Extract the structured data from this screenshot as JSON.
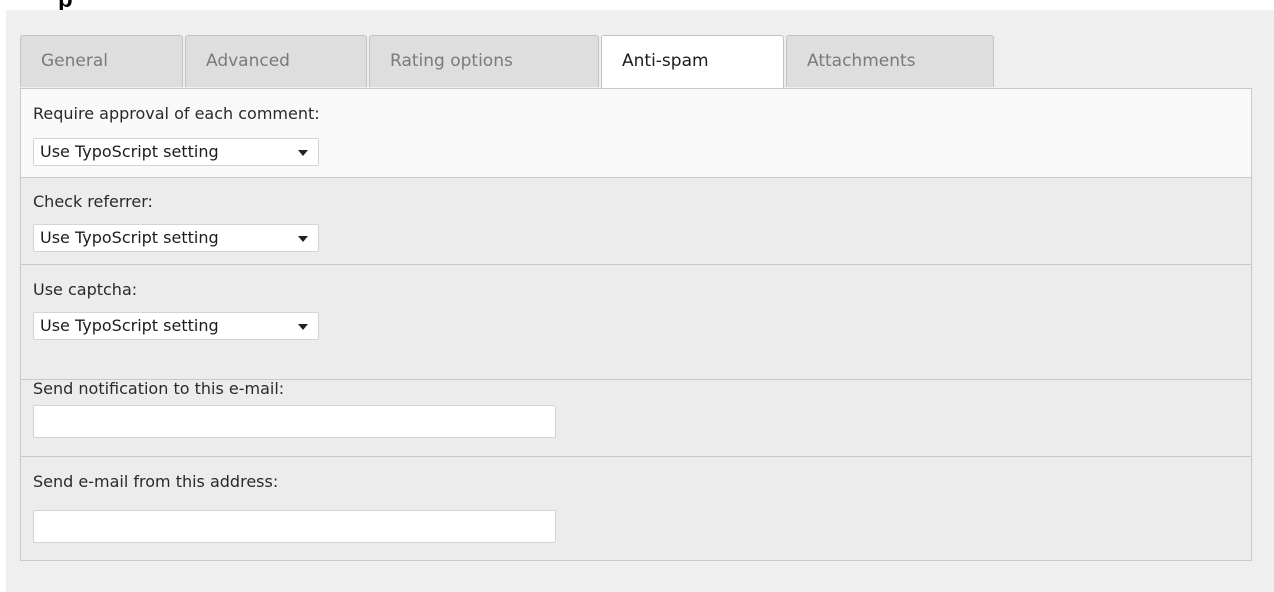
{
  "tabs": [
    {
      "label": "General",
      "active": false
    },
    {
      "label": "Advanced",
      "active": false
    },
    {
      "label": "Rating options",
      "active": false
    },
    {
      "label": "Anti-spam",
      "active": true
    },
    {
      "label": "Attachments",
      "active": false
    }
  ],
  "fields": {
    "approval": {
      "label": "Require approval of each comment:",
      "value": "Use TypoScript setting"
    },
    "referrer": {
      "label": "Check referrer:",
      "value": "Use TypoScript setting"
    },
    "captcha": {
      "label": "Use captcha:",
      "value": "Use TypoScript setting"
    },
    "notify_email": {
      "label": "Send notification to this e-mail:",
      "value": ""
    },
    "from_email": {
      "label": "Send e-mail from this address:",
      "value": ""
    }
  },
  "colors": {
    "panel_bg": "#efefef",
    "active_tab_bg": "#ffffff",
    "inactive_tab_bg": "#dedede",
    "border": "#c8c8c8"
  }
}
